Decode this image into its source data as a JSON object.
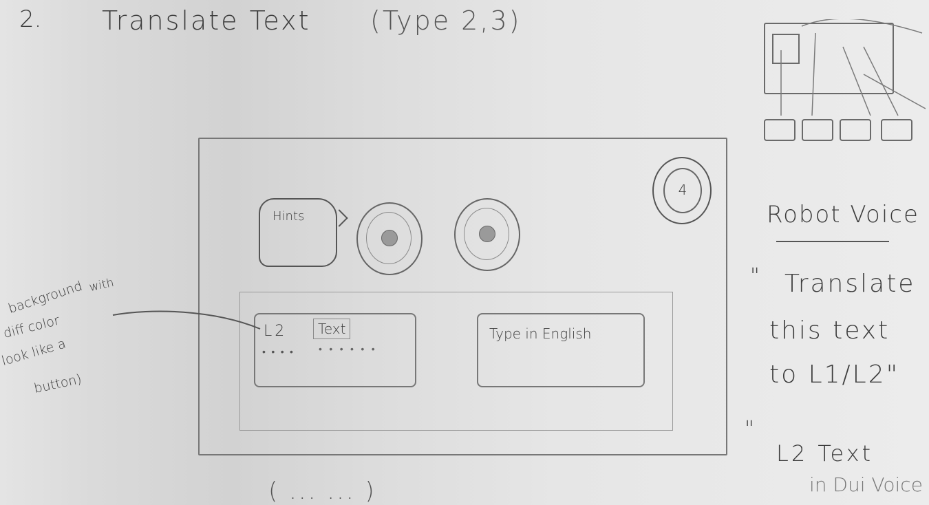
{
  "title": {
    "number": "2.",
    "text": "Translate Text",
    "subtitle": "(Type 2,3)"
  },
  "wireframe": {
    "hints_label": "Hints",
    "timer_value": "4",
    "l2_label": "L2",
    "l2_text": "Text",
    "l2_underline": "• • • •",
    "l2_text_underline": "• • • • • •",
    "english_placeholder": "Type in English"
  },
  "annotation": {
    "lines": [
      "background",
      "with",
      "diff color",
      "look like a",
      "button)"
    ]
  },
  "notes": {
    "heading": "Robot Voice",
    "quote_open_1": "\"",
    "lines": [
      "Translate",
      "this text",
      "to L1/L2\""
    ],
    "quote_open_2": "\"",
    "line4": "L2   Text",
    "line5": "in Dui Voice"
  },
  "bottom_text": "( ... ... )"
}
